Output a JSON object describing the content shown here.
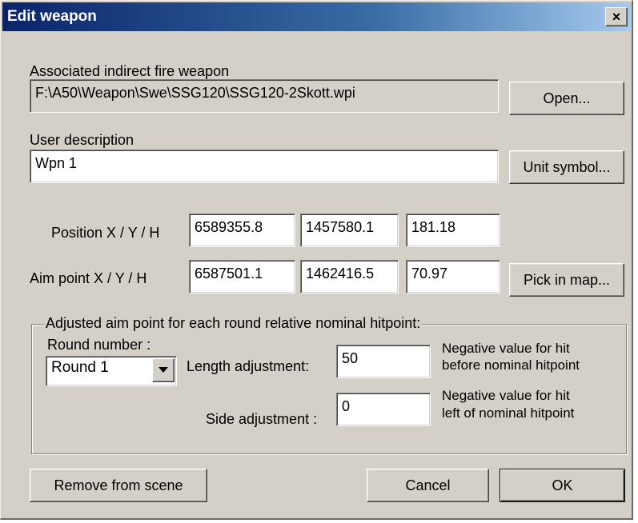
{
  "window": {
    "title": "Edit weapon",
    "close_glyph": "×"
  },
  "weapon": {
    "label": "Associated indirect fire weapon",
    "path": "F:\\A50\\Weapon\\Swe\\SSG120\\SSG120-2Skott.wpi",
    "open_button": "Open..."
  },
  "description": {
    "label": "User description",
    "value": "Wpn  1",
    "unit_symbol_button": "Unit symbol..."
  },
  "position": {
    "label": "Position X / Y / H",
    "x": "6589355.8",
    "y": "1457580.1",
    "h": "181.18"
  },
  "aim_point": {
    "label": "Aim point  X / Y / H",
    "x": "6587501.1",
    "y": "1462416.5",
    "h": "70.97",
    "pick_button": "Pick in map..."
  },
  "adjust": {
    "group_label": "Adjusted aim point for each round relative nominal hitpoint:",
    "round_label": "Round number :",
    "round_value": "Round  1",
    "length_label": "Length adjustment:",
    "length_value": "50",
    "length_note_1": "Negative value for hit",
    "length_note_2": "before nominal hitpoint",
    "side_label": "Side adjustment :",
    "side_value": "0",
    "side_note_1": "Negative value for hit",
    "side_note_2": "left of nominal hitpoint"
  },
  "footer": {
    "remove_button": "Remove from scene",
    "cancel_button": "Cancel",
    "ok_button": "OK"
  }
}
